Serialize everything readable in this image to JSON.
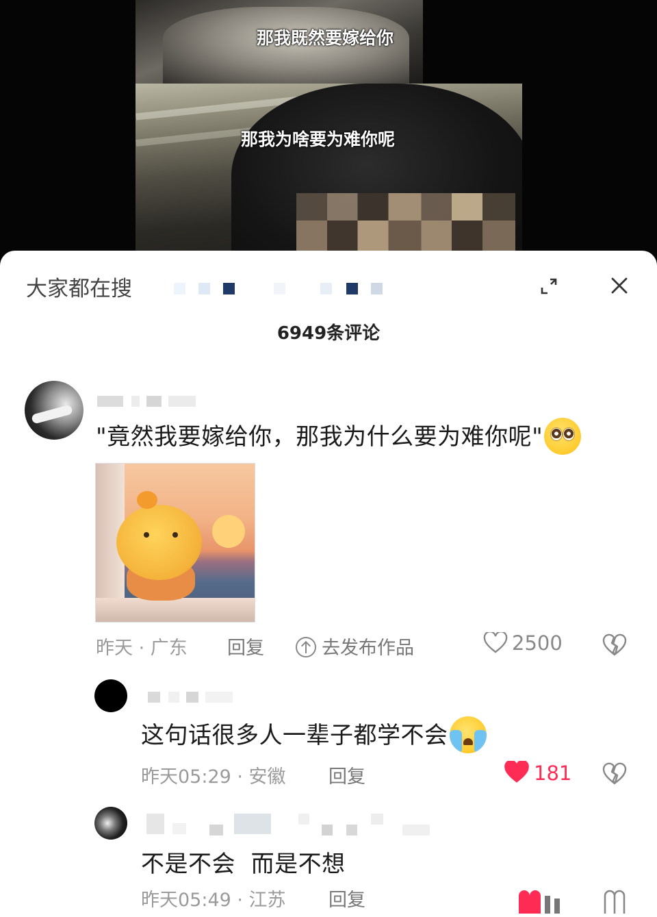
{
  "video": {
    "subtitle_top": "那我既然要嫁给你",
    "subtitle_main": "那我为啥要为难你呢"
  },
  "sheet": {
    "search_label": "大家都在搜",
    "expand_icon": "expand-icon",
    "close_icon": "close-icon",
    "comment_count": "6949条评论"
  },
  "comments": [
    {
      "text": "\"竟然我要嫁给你，那我为什么要为难你呢\"",
      "emoji": "pleading-face",
      "time": "昨天 · 广东",
      "reply_label": "回复",
      "post_label": "去发布作品",
      "likes": "2500",
      "liked": false
    },
    {
      "text": "这句话很多人一辈子都学不会",
      "emoji": "loudly-crying-face",
      "time": "昨天05:29 · 安徽",
      "reply_label": "回复",
      "likes": "181",
      "liked": true
    },
    {
      "text": "不是不会  而是不想",
      "time": "昨天05:49 · 江苏",
      "reply_label": "回复"
    }
  ],
  "colors": {
    "like_active": "#fe2c55",
    "meta_gray": "#9a9a9a"
  }
}
